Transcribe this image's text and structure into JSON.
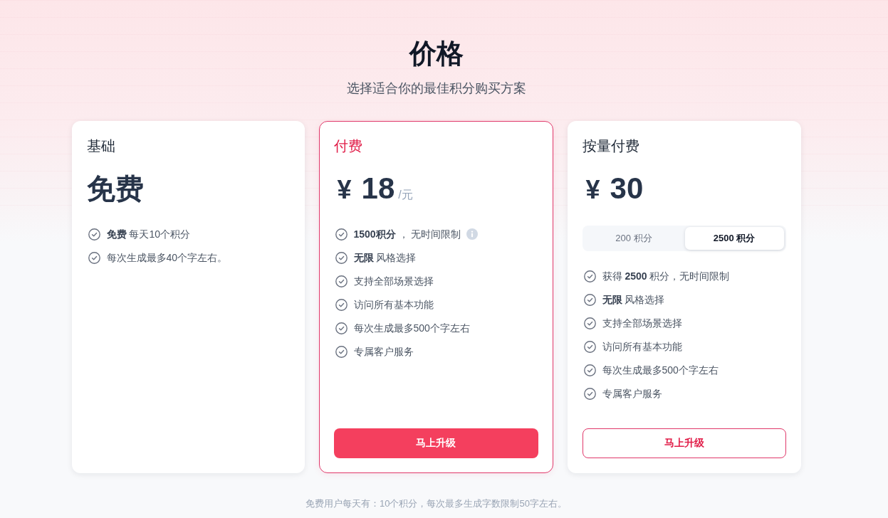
{
  "header": {
    "title": "价格",
    "subtitle": "选择适合你的最佳积分购买方案"
  },
  "plans": [
    {
      "name": "基础",
      "highlighted": false,
      "price": {
        "kind": "text",
        "amount": "免费"
      },
      "features": [
        {
          "text": "**免费** 每天10个积分",
          "info": false
        },
        {
          "text": "每次生成最多40个字左右。",
          "info": false
        }
      ]
    },
    {
      "name": "付费",
      "highlighted": true,
      "price": {
        "kind": "currency",
        "symbol": "¥",
        "amount": "18",
        "unit": "/元"
      },
      "features": [
        {
          "text": "**1500积分** ， 无时间限制",
          "info": true
        },
        {
          "text": "**无限** 风格选择",
          "info": false
        },
        {
          "text": "支持全部场景选择",
          "info": false
        },
        {
          "text": "访问所有基本功能",
          "info": false
        },
        {
          "text": "每次生成最多500个字左右",
          "info": false
        },
        {
          "text": "专属客户服务",
          "info": false
        }
      ],
      "button": {
        "label": "马上升级",
        "kind": "primary"
      }
    },
    {
      "name": "按量付费",
      "highlighted": false,
      "price": {
        "kind": "currency",
        "symbol": "¥",
        "amount": "30"
      },
      "options": [
        {
          "label": "200 积分",
          "selected": false
        },
        {
          "label": "2500 积分",
          "selected": true
        }
      ],
      "features": [
        {
          "text": "获得 **2500** 积分，无时间限制",
          "info": false
        },
        {
          "text": "**无限** 风格选择",
          "info": false
        },
        {
          "text": "支持全部场景选择",
          "info": false
        },
        {
          "text": "访问所有基本功能",
          "info": false
        },
        {
          "text": "每次生成最多500个字左右",
          "info": false
        },
        {
          "text": "专属客户服务",
          "info": false
        }
      ],
      "button": {
        "label": "马上升级",
        "kind": "outline"
      }
    }
  ],
  "footnote": "免费用户每天有：10个积分，每次最多生成字数限制50字左右。"
}
